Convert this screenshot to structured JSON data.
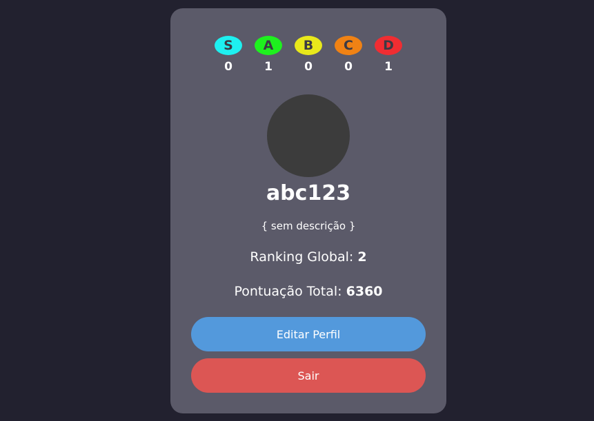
{
  "grades": [
    {
      "letter": "S",
      "count": "0",
      "color": "#1ef0f0"
    },
    {
      "letter": "A",
      "count": "1",
      "color": "#1ef01e"
    },
    {
      "letter": "B",
      "count": "0",
      "color": "#e9e91b"
    },
    {
      "letter": "C",
      "count": "0",
      "color": "#f08214"
    },
    {
      "letter": "D",
      "count": "1",
      "color": "#f02d32"
    }
  ],
  "profile": {
    "username": "abc123",
    "description": "{ sem descrição }",
    "ranking_label": "Ranking Global:",
    "ranking_value": "2",
    "score_label": "Pontuação Total:",
    "score_value": "6360"
  },
  "buttons": {
    "edit_label": "Editar Perfil",
    "edit_color": "#5399dc",
    "logout_label": "Sair",
    "logout_color": "#dc5654"
  }
}
